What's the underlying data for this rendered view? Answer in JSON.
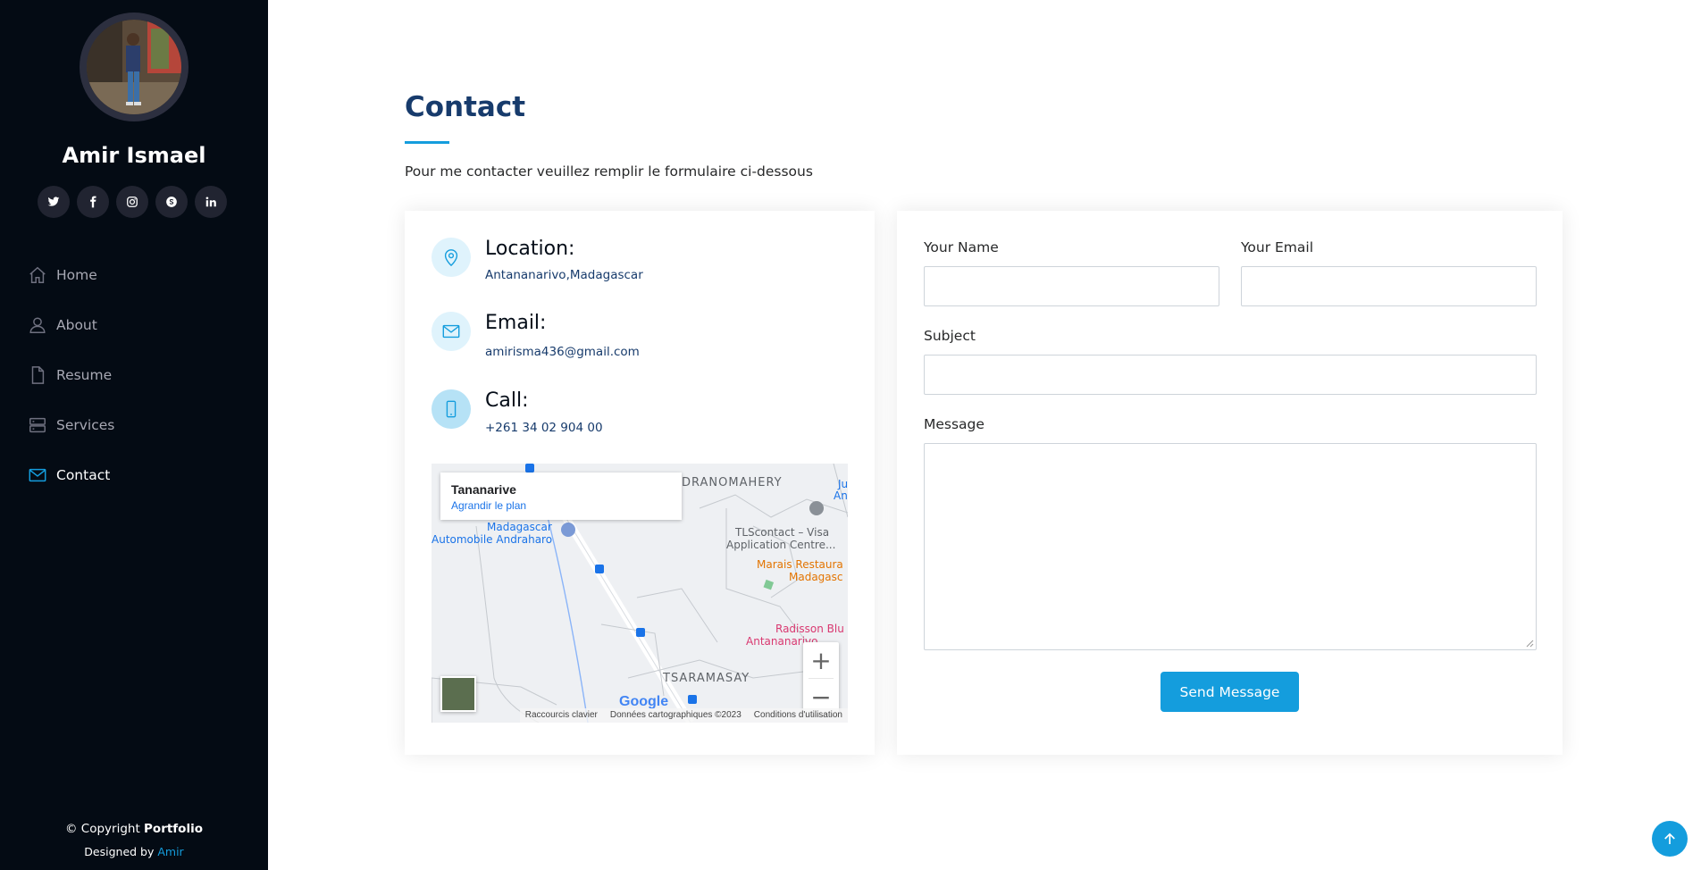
{
  "profile": {
    "name": "Amir Ismael"
  },
  "social": [
    {
      "icon": "twitter-icon"
    },
    {
      "icon": "facebook-icon"
    },
    {
      "icon": "instagram-icon"
    },
    {
      "icon": "skype-icon"
    },
    {
      "icon": "linkedin-icon"
    }
  ],
  "nav": {
    "items": [
      {
        "label": "Home",
        "icon": "home-icon"
      },
      {
        "label": "About",
        "icon": "person-icon"
      },
      {
        "label": "Resume",
        "icon": "file-icon"
      },
      {
        "label": "Services",
        "icon": "server-icon"
      },
      {
        "label": "Contact",
        "icon": "envelope-icon",
        "active": true
      }
    ]
  },
  "footer": {
    "copyright_prefix": "© Copyright ",
    "copyright_brand": "Portfolio",
    "designed_prefix": "Designed by ",
    "designer": "Amir"
  },
  "contact": {
    "title": "Contact",
    "description": "Pour me contacter veuillez remplir le formulaire ci-dessous",
    "location": {
      "heading": "Location:",
      "value": "Antananarivo,Madagascar"
    },
    "email": {
      "heading": "Email:",
      "value": "amirisma436@gmail.com"
    },
    "call": {
      "heading": "Call:",
      "value": "+261 34 02 904 00"
    }
  },
  "map": {
    "place": "Tananarive",
    "enlarge_link": "Agrandir le plan",
    "labels": {
      "andranomahery": "DRANOMAHERY",
      "ju": "Ju",
      "an": "An",
      "madagascar_auto_1": "Madagascar",
      "madagascar_auto_2": "Automobile Andraharo",
      "tlscontact_1": "TLScontact – Visa",
      "tlscontact_2": "Application Centre...",
      "marais_1": "Marais Restaura",
      "marais_2": "Madagasc",
      "radisson_1": "Radisson Blu",
      "radisson_2": "Antananarivo",
      "tsaramasay": "TSARAMASAY"
    },
    "zoom_in": "+",
    "zoom_out": "−",
    "logo": "Google",
    "attribution": {
      "shortcuts": "Raccourcis clavier",
      "data": "Données cartographiques ©2023",
      "terms": "Conditions d'utilisation"
    }
  },
  "form": {
    "name_label": "Your Name",
    "email_label": "Your Email",
    "subject_label": "Subject",
    "message_label": "Message",
    "name_value": "",
    "email_value": "",
    "subject_value": "",
    "message_value": "",
    "send_label": "Send Message"
  },
  "colors": {
    "accent": "#149ddd",
    "sidebar_bg": "#040b14",
    "title": "#173b6c"
  }
}
